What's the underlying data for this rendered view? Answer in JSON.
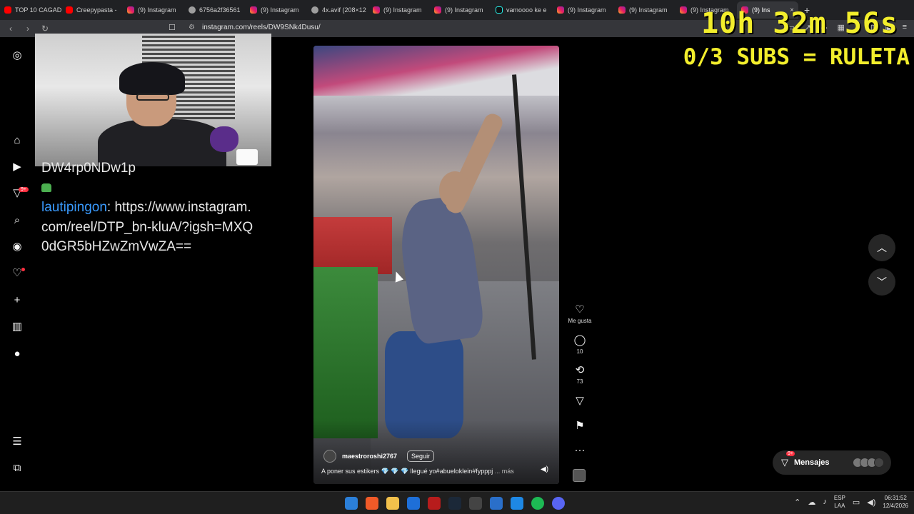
{
  "browser": {
    "tabs": [
      {
        "label": "TOP 10 CAGAD",
        "icon": "youtube-icon",
        "favclass": "yt"
      },
      {
        "label": "Creepypasta -",
        "icon": "youtube-icon",
        "favclass": "yt"
      },
      {
        "label": "(9) Instagram",
        "icon": "instagram-icon",
        "favclass": "ig"
      },
      {
        "label": "6756a2f36561",
        "icon": "globe-icon",
        "favclass": "globe"
      },
      {
        "label": "(9) Instagram",
        "icon": "instagram-icon",
        "favclass": "ig"
      },
      {
        "label": "4x.avif (208×12",
        "icon": "globe-icon",
        "favclass": "globe"
      },
      {
        "label": "(9) Instagram",
        "icon": "instagram-icon",
        "favclass": "ig"
      },
      {
        "label": "(9) Instagram",
        "icon": "instagram-icon",
        "favclass": "ig"
      },
      {
        "label": "vamoooo ke e",
        "icon": "tiktok-icon",
        "favclass": "tt"
      },
      {
        "label": "(9) Instagram",
        "icon": "instagram-icon",
        "favclass": "ig"
      },
      {
        "label": "(9) Instagram",
        "icon": "instagram-icon",
        "favclass": "ig"
      },
      {
        "label": "(9) Instagram",
        "icon": "instagram-icon",
        "favclass": "ig"
      },
      {
        "label": "(9) Ins",
        "icon": "instagram-icon",
        "favclass": "ig",
        "active": true
      }
    ],
    "url": "instagram.com/reels/DW9SNk4Dusu/"
  },
  "overlay": {
    "timer": "10h 32m 56s",
    "subs": "0/3 SUBS = RULETA"
  },
  "chat": {
    "line1": "DW4rp0NDw1p",
    "username": "lautipingon",
    "message": ": https://www.instagram.com/reel/DTP_bn-kluA/?igsh=MXQ0dGR5bHZwZmVwZA=="
  },
  "nav": {
    "notifications_badge": "9+"
  },
  "reel": {
    "username": "maestroroshi2767",
    "follow_label": "Seguir",
    "caption": "A poner sus estikers 💎 💎 💎 llegué yo#abueloklein#fypppj",
    "more_label": "... más",
    "likes_label": "Me gusta",
    "comments_count": "10",
    "reposts_count": "73"
  },
  "messages": {
    "label": "Mensajes",
    "badge": "9+"
  },
  "taskbar": {
    "lang_top": "ESP",
    "lang_bottom": "LAA",
    "time": "06:31:52",
    "date": "12/4/2026"
  },
  "colors": {
    "overlay_text": "#f3ee2c",
    "username_blue": "#3a9bff",
    "badge_red": "#ff3040"
  }
}
